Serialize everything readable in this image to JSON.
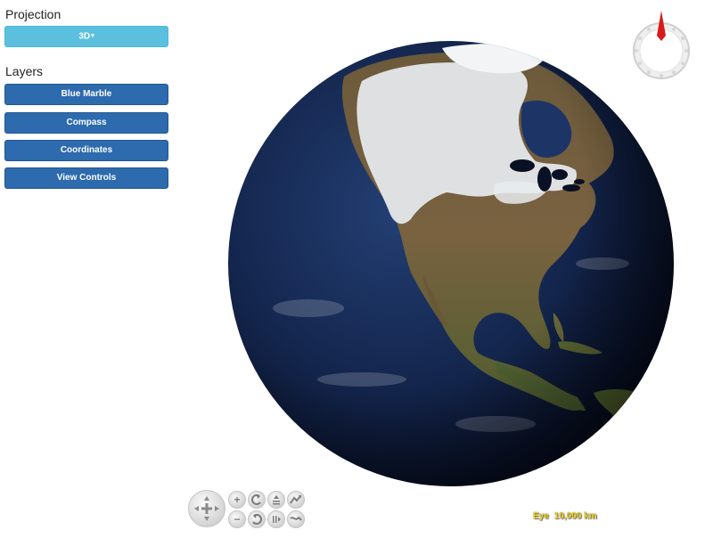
{
  "projection": {
    "title": "Projection",
    "button_label": "3D",
    "caret": "▾"
  },
  "layers": {
    "title": "Layers",
    "items": [
      {
        "label": "Blue Marble"
      },
      {
        "label": "Compass"
      },
      {
        "label": "Coordinates"
      },
      {
        "label": "View Controls"
      }
    ]
  },
  "globe": {
    "view": "north-america",
    "imagery": "Blue Marble"
  },
  "compass": {
    "needle_heading_deg": 0,
    "needle_color": "#d81b1b"
  },
  "view_controls": {
    "icons": [
      "pan-icon",
      "zoom-in-icon",
      "heading-left-icon",
      "tilt-up-icon",
      "exaggeration-up-icon",
      "zoom-out-icon",
      "heading-right-icon",
      "tilt-down-icon",
      "exaggeration-down-icon"
    ]
  },
  "eye": {
    "label": "Eye",
    "value": "10,000 km"
  },
  "colors": {
    "projection_button": "#5bc0de",
    "layer_button": "#2d6bae",
    "eye_text": "#f2d21e"
  }
}
